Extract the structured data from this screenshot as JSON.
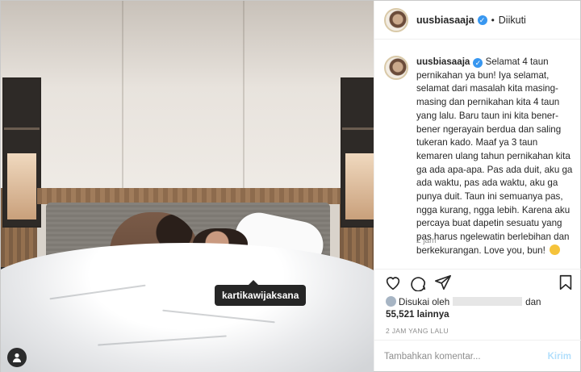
{
  "post": {
    "username": "uusbiasaaja",
    "verified_icon": "verified-badge-icon",
    "separator": "•",
    "follow_status": "Diikuti",
    "caption": "Selamat 4 taun pernikahan ya bun! Iya selamat, selamat dari masalah kita masing-masing dan pernikahan kita 4 taun yang lalu. Baru taun ini kita bener-bener ngerayain berdua dan saling tukeran kado. Maaf ya 3 taun kemaren ulang tahun pernikahan kita ga ada apa-apa. Pas ada duit, aku ga ada waktu, pas ada waktu, aku ga punya duit. Taun ini semuanya pas, ngga kurang, ngga lebih. Karena aku percaya buat dapetin sesuatu yang pas harus ngelewatin berlebihan dan berkekurangan. Love you, bun!",
    "caption_time": "2 jam",
    "photo_tag": "kartikawijaksana",
    "liked_by_prefix": "Disukai oleh",
    "liked_by_and": "dan",
    "likes_count": "55,521 lainnya",
    "posted_ago": "2 JAM YANG LALU",
    "comment_placeholder": "Tambahkan komentar...",
    "send_label": "Kirim"
  },
  "icons": {
    "like": "heart-icon",
    "comment": "comment-icon",
    "share": "share-icon",
    "save": "bookmark-icon",
    "tag": "user-tag-icon"
  },
  "colors": {
    "verified": "#3897f0",
    "send_disabled": "#b2dffc",
    "muted_text": "#8e8e8e"
  }
}
